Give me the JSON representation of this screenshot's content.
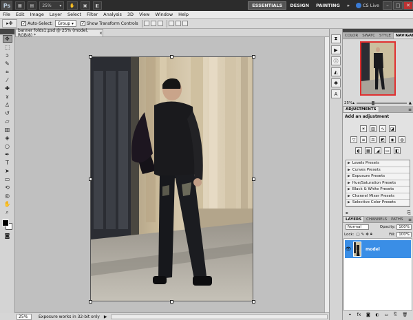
{
  "app": {
    "logo": "Ps",
    "zoom": "25%"
  },
  "workspaces": {
    "essentials": "ESSENTIALS",
    "design": "DESIGN",
    "painting": "PAINTING",
    "more": "»",
    "cslive": "CS Live"
  },
  "window_controls": {
    "minimize": "–",
    "restore": "□",
    "close": "✕"
  },
  "menu": [
    "File",
    "Edit",
    "Image",
    "Layer",
    "Select",
    "Filter",
    "Analysis",
    "3D",
    "View",
    "Window",
    "Help"
  ],
  "options": {
    "auto_select_label": "Auto-Select:",
    "auto_select_value": "Group",
    "show_transform_label": "Show Transform Controls"
  },
  "document": {
    "tab_title": "banner folds1.psd @ 25% (model, RGB/8) *",
    "tab_close": "×"
  },
  "status": {
    "zoom": "25%",
    "message": "Exposure works in 32-bit only",
    "arrow": "▶"
  },
  "navigator": {
    "tabs": [
      "COLOR",
      "SWATC",
      "STYLE",
      "NAVIGATOR"
    ],
    "zoom": "25%"
  },
  "adjustments": {
    "tab": "ADJUSTMENTS",
    "title": "Add an adjustment",
    "presets": [
      "Levels Presets",
      "Curves Presets",
      "Exposure Presets",
      "Hue/Saturation Presets",
      "Black & White Presets",
      "Channel Mixer Presets",
      "Selective Color Presets"
    ]
  },
  "layers": {
    "tabs": [
      "LAYERS",
      "CHANNELS",
      "PATHS"
    ],
    "blend_mode": "Normal",
    "opacity_label": "Opacity:",
    "opacity_value": "100%",
    "lock_label": "Lock:",
    "fill_label": "Fill:",
    "fill_value": "100%",
    "layer_name": "model"
  },
  "colors": {
    "accent": "#3a8ee6",
    "nav_frame": "#e03030",
    "appbar": "#2c2c2c"
  }
}
